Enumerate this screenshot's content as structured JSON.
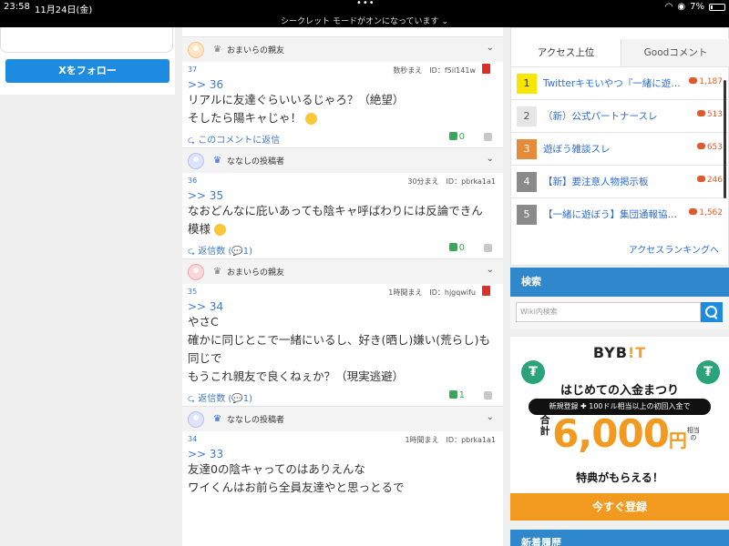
{
  "status": {
    "time": "23:58",
    "date": "11月24日(金)",
    "incognito": "シークレット モードがオンになっています",
    "battery": "7%"
  },
  "left": {
    "follow_label": "Xをフォロー"
  },
  "comments": [
    {
      "num": "37",
      "anchor": ">> 36",
      "name": "おまいらの親友",
      "meta": "数秒まえ　ID：f5il141w",
      "lines": [
        "リアルに友達ぐらいいるじゃろ？（絶望）",
        "そしたら陽キャじゃ！"
      ],
      "reply": "このコメントに返信",
      "likes": "0",
      "avatar": "orange",
      "crown": "gray",
      "trash": true
    },
    {
      "num": "36",
      "anchor": ">> 35",
      "name": "ななしの投稿者",
      "meta": "30分まえ　ID：pbrka1a1",
      "lines": [
        "なおどんなに庇いあっても陰キャ呼ばわりには反論できん",
        "模様"
      ],
      "reply": "返信数 (",
      "reply_count": "1",
      "likes": "0",
      "avatar": "blue",
      "crown": "blue",
      "trash": false
    },
    {
      "num": "35",
      "anchor": ">> 34",
      "name": "おまいらの親友",
      "meta": "1時間まえ　ID：hjgqwifu",
      "lines": [
        "やさC",
        "確かに同じとこで一緒にいるし、好き(晒し)嫌い(荒らし)も",
        "同じで",
        "もうこれ親友で良くねぇか？（現実逃避）"
      ],
      "reply": "返信数 (",
      "reply_count": "1",
      "likes": "1",
      "avatar": "pink",
      "crown": "gray",
      "trash": true
    },
    {
      "num": "34",
      "anchor": ">> 33",
      "name": "ななしの投稿者",
      "meta": "1時間まえ　ID：pbrka1a1",
      "lines": [
        "友達0の陰キャってのはありえんな",
        "ワイくんはお前ら全員友達やと思っとるで"
      ],
      "reply": "",
      "likes": "",
      "avatar": "blue",
      "crown": "blue",
      "trash": false
    }
  ],
  "ranking": {
    "tab_active": "アクセス上位",
    "tab_other": "Goodコメント",
    "items": [
      {
        "rank": "1",
        "title": "Twitterキモいやつ『一緒に遊…",
        "count": "1,187",
        "bg": "#f7e600",
        "fg": "#333"
      },
      {
        "rank": "2",
        "title": "（新）公式パートナースレ",
        "count": "513",
        "bg": "#e6e6e6",
        "fg": "#555"
      },
      {
        "rank": "3",
        "title": "遊ぼう雑談スレ",
        "count": "653",
        "bg": "#e58b3a",
        "fg": "#fff"
      },
      {
        "rank": "4",
        "title": "【新】要注意人物掲示板",
        "count": "246",
        "bg": "#8a8a8a",
        "fg": "#fff"
      },
      {
        "rank": "5",
        "title": "【一緒に遊ぼう】集団通報協…",
        "count": "1,562",
        "bg": "#8a8a8a",
        "fg": "#fff"
      }
    ],
    "more": "アクセスランキングへ"
  },
  "search": {
    "heading": "検索",
    "placeholder": "Wiki内検索"
  },
  "ad": {
    "brand": "BYB",
    "brand_accent": "!T",
    "headline": "はじめての入金まつり",
    "pill": "新規登録 ✚ 100ドル相当以上の初回入金で",
    "prefix": "合計",
    "amount": "6,000",
    "unit": "円",
    "suffix": "相当の",
    "sub_headline": "特典がもらえる！",
    "cta": "今すぐ登録",
    "coin_symbol": "₮"
  },
  "new_section": {
    "heading": "新着履歴"
  }
}
